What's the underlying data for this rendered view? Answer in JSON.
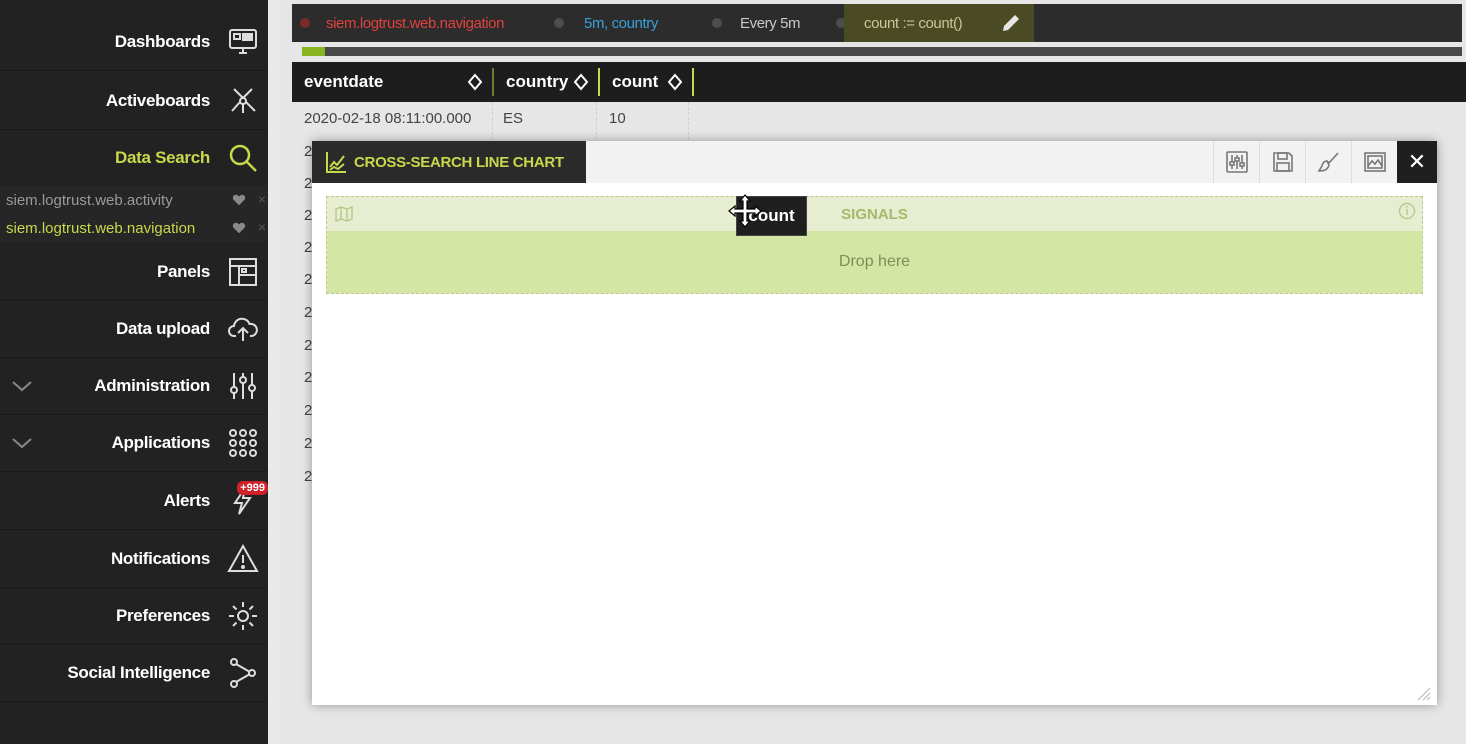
{
  "sidebar": {
    "items": [
      {
        "label": "Dashboards",
        "icon": "dashboard-icon"
      },
      {
        "label": "Activeboards",
        "icon": "network-icon"
      },
      {
        "label": "Data Search",
        "icon": "search-icon",
        "active": true
      },
      {
        "label": "Panels",
        "icon": "panels-icon"
      },
      {
        "label": "Data upload",
        "icon": "cloud-upload-icon"
      },
      {
        "label": "Administration",
        "icon": "sliders-icon",
        "expandable": true
      },
      {
        "label": "Applications",
        "icon": "grid-icon",
        "expandable": true
      },
      {
        "label": "Alerts",
        "icon": "bolt-icon",
        "badge": "+999"
      },
      {
        "label": "Notifications",
        "icon": "warning-icon"
      },
      {
        "label": "Preferences",
        "icon": "gear-icon"
      },
      {
        "label": "Social Intelligence",
        "icon": "share-icon"
      }
    ],
    "open_searches": [
      {
        "label": "siem.logtrust.web.activity",
        "active": false
      },
      {
        "label": "siem.logtrust.web.navigation",
        "active": true
      }
    ]
  },
  "topbar": {
    "crumbs": [
      {
        "label": "siem.logtrust.web.navigation",
        "color": "#e0413c"
      },
      {
        "label": "̉5m, country",
        "display": "5m, country",
        "color": "#3aa0d8"
      },
      {
        "label": "Every 5m",
        "color": "#c9c9c9"
      },
      {
        "label": "count := count()",
        "color": "#c8c89a"
      }
    ]
  },
  "progress": {
    "fraction": 0.02
  },
  "table": {
    "columns": [
      "eventdate",
      "country",
      "count"
    ],
    "rows": [
      [
        "2020-02-18 08:11:00.000",
        "ES",
        "10"
      ]
    ],
    "truncated_rows": [
      "2",
      "2",
      "2",
      "2",
      "2",
      "2",
      "2",
      "2",
      "2",
      "2",
      "2"
    ]
  },
  "panel": {
    "title": "CROSS-SEARCH LINE CHART",
    "signals_label": "SIGNALS",
    "drop_label": "Drop here",
    "close_glyph": "✕",
    "tools": [
      "sliders-icon",
      "save-icon",
      "brush-icon",
      "image-icon"
    ]
  },
  "drag_chip": {
    "label": "count"
  },
  "colors": {
    "accent": "#c7d84a",
    "sidebar_bg": "#222222",
    "drop_zone": "#d4e6a4",
    "badge": "#d0202a"
  }
}
